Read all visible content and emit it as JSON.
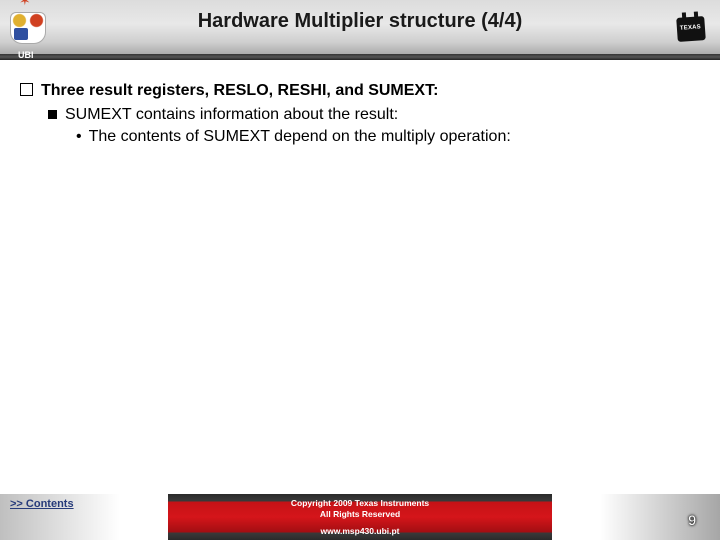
{
  "header": {
    "title": "Hardware Multiplier structure (4/4)",
    "left_label": "UBI",
    "ti_text": "TEXAS"
  },
  "content": {
    "bullet1": "Three result registers, RESLO, RESHI, and SUMEXT:",
    "bullet2": "SUMEXT contains information about the result:",
    "bullet3": "The contents of SUMEXT depend on the multiply operation:"
  },
  "footer": {
    "contents_link": ">> Contents",
    "copyright_line1": "Copyright  2009 Texas Instruments",
    "copyright_line2": "All Rights Reserved",
    "url": "www.msp430.ubi.pt",
    "page_number": "9"
  }
}
